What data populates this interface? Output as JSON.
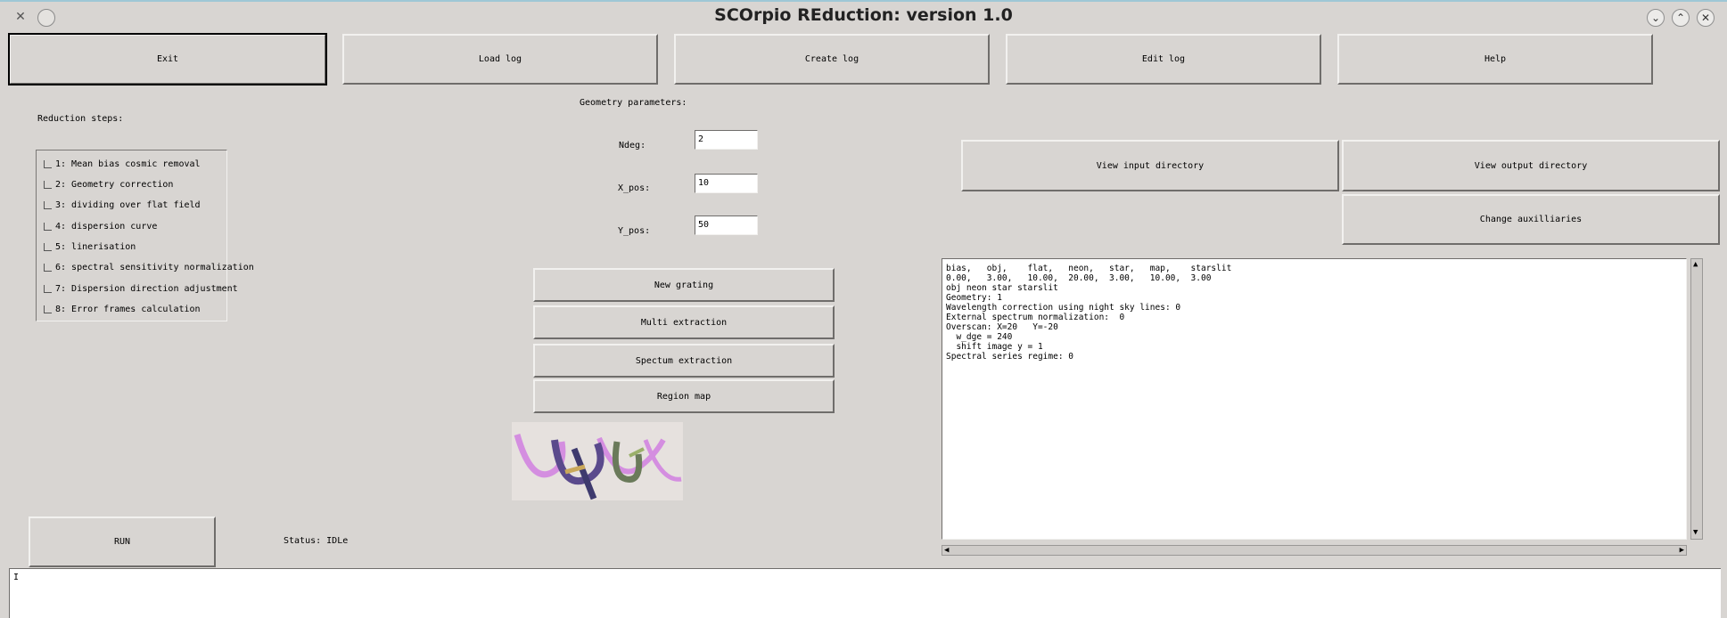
{
  "window": {
    "title": "SCOrpio REduction: version  1.0"
  },
  "toolbar": {
    "exit": "Exit",
    "load_log": "Load log",
    "create_log": "Create log",
    "edit_log": "Edit log",
    "help": "Help"
  },
  "reduction": {
    "label": "Reduction steps:",
    "steps": [
      "1: Mean bias  cosmic removal",
      "2: Geometry correction",
      "3: dividing over flat field",
      "4: dispersion curve",
      "5: linerisation",
      "6: spectral sensitivity normalization",
      "7: Dispersion direction adjustment",
      "8: Error frames calculation"
    ]
  },
  "geometry": {
    "label": "Geometry parameters:",
    "ndeg_label": "Ndeg:",
    "ndeg_value": "2",
    "xpos_label": "X_pos:",
    "xpos_value": "10",
    "ypos_label": "Y_pos:",
    "ypos_value": "50"
  },
  "actions": {
    "new_grating": "New grating",
    "multi_extraction": "Multi extraction",
    "spectrum_extraction": "Spectum extraction",
    "region_map": "Region map"
  },
  "directories": {
    "view_input": "View input directory",
    "view_output": "View output directory",
    "change_aux": "Change auxilliaries"
  },
  "log_text": "bias,   obj,    flat,   neon,   star,   map,    starslit\n0.00,   3.00,   10.00,  20.00,  3.00,   10.00,  3.00\nobj neon star starslit\nGeometry: 1\nWavelength correction using night sky lines: 0\nExternal spectrum normalization:  0\nOverscan: X=20   Y=-20\n  w_dge = 240\n  shift image y = 1\nSpectral series regime: 0",
  "run": {
    "label": "RUN",
    "status": "Status: IDLe"
  },
  "console": {
    "text": "I"
  }
}
